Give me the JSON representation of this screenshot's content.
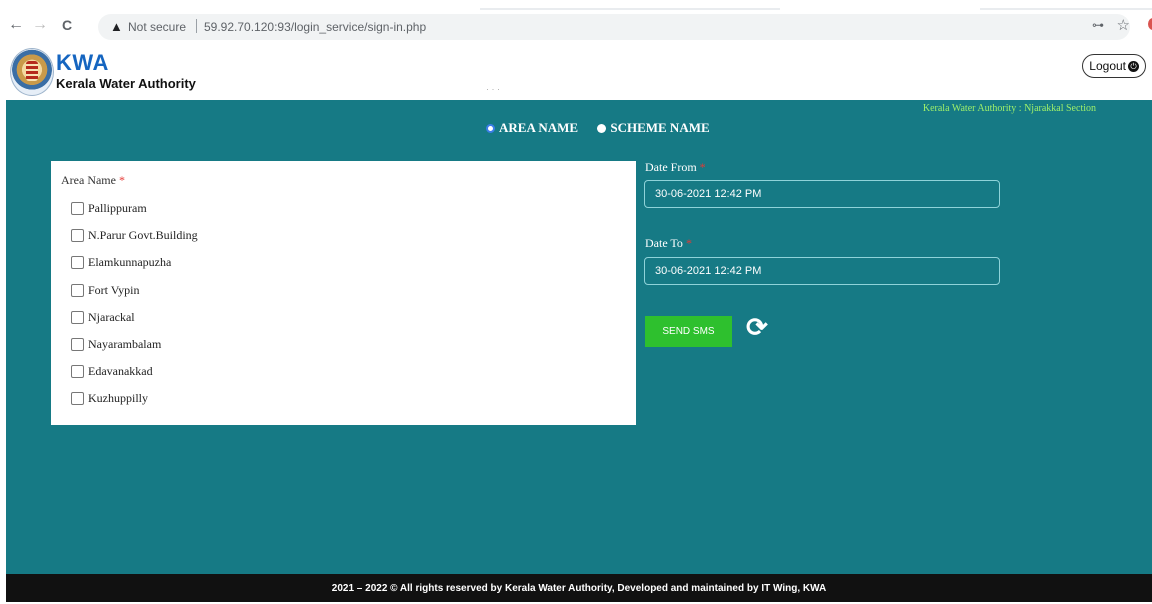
{
  "browser": {
    "back": "←",
    "forward": "→",
    "reload": "C",
    "security_icon": "▲",
    "security_text": "Not secure",
    "url": "59.92.70.120:93/login_service/sign-in.php"
  },
  "header": {
    "brand_short": "KWA",
    "brand_long": "Kerala Water Authority",
    "logout_label": "Logout"
  },
  "main": {
    "section_label": "Kerala Water Authority : Njarakkal Section",
    "radio_options": [
      "AREA NAME",
      "SCHEME NAME"
    ],
    "selected_option": "AREA NAME",
    "area_label": "Area Name",
    "required_mark": "*",
    "areas": [
      "Pallippuram",
      "N.Parur Govt.Building",
      "Elamkunnapuzha",
      "Fort Vypin",
      "Njarackal",
      "Nayarambalam",
      "Edavanakkad",
      "Kuzhuppilly"
    ],
    "date_from_label": "Date From",
    "date_from_value": "30-06-2021 12:42 PM",
    "date_to_label": "Date To",
    "date_to_value": "30-06-2021 12:42 PM",
    "send_button": "SEND SMS"
  },
  "footer": {
    "text": "2021 – 2022 © All rights reserved by Kerala Water Authority, Developed and maintained by IT Wing, KWA"
  },
  "colors": {
    "teal": "#167a85",
    "accent_green": "#2ec02e",
    "section_label": "#9ef06b",
    "brand_blue": "#1565c0"
  }
}
